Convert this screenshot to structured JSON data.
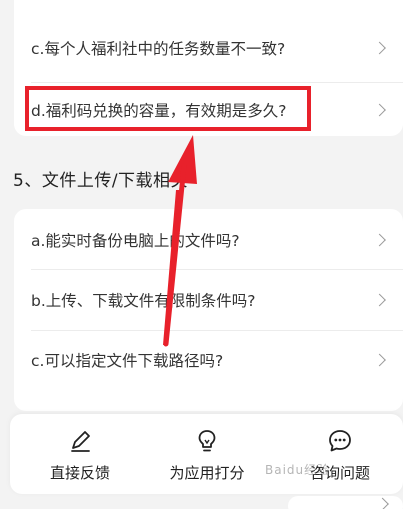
{
  "faq_top": {
    "items": [
      {
        "label": "c.每个人福利社中的任务数量不一致?"
      },
      {
        "label": "d.福利码兑换的容量，有效期是多久?"
      }
    ]
  },
  "section": {
    "title": "5、文件上传/下载相关"
  },
  "faq_section5": {
    "items": [
      {
        "label": "a.能实时备份电脑上的文件吗?"
      },
      {
        "label": "b.上传、下载文件有限制条件吗?"
      },
      {
        "label": "c.可以指定文件下载路径吗?"
      }
    ]
  },
  "bottom_bar": {
    "items": [
      {
        "label": "直接反馈",
        "icon": "pencil-icon"
      },
      {
        "label": "为应用打分",
        "icon": "lightbulb-icon"
      },
      {
        "label": "咨询问题",
        "icon": "chat-bubble-icon"
      }
    ]
  },
  "watermark": {
    "text": "Baidu经验"
  },
  "colors": {
    "annotation_red": "#e8212b",
    "card_bg": "#ffffff",
    "page_bg": "#f3f3f3",
    "chevron": "#9a9a9a"
  }
}
